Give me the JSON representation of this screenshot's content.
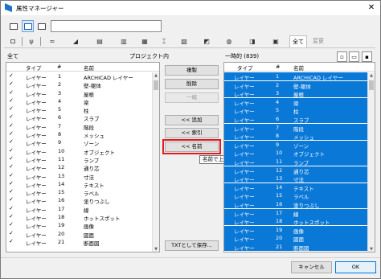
{
  "window": {
    "title": "属性マネージャー",
    "close_glyph": "✕"
  },
  "toolbar": {
    "view_buttons": [
      "list-view-icon",
      "detail-view-icon",
      "split-view-icon"
    ],
    "search_value": "",
    "categories": [
      "layer-icon",
      "pen-icon",
      "line-type-icon",
      "fill-icon",
      "surface-icon",
      "material-icon",
      "composite-icon",
      "profile-icon",
      "zone-icon",
      "mep-icon",
      "city-icon",
      "renovation-icon",
      "building-icon"
    ],
    "tabs": [
      {
        "label": "全て",
        "active": true
      },
      {
        "label": "変更",
        "active": false
      }
    ]
  },
  "left_panel": {
    "caption": "全て",
    "source": "プロジェクト内",
    "columns": {
      "type": "タイプ",
      "num": "#",
      "name": "名前"
    },
    "rows": [
      {
        "check": "✓",
        "type": "レイヤー",
        "num": "1",
        "name": "ARCHICAD レイヤー"
      },
      {
        "check": "✓",
        "type": "レイヤー",
        "num": "2",
        "name": "壁-躯体"
      },
      {
        "check": "✓",
        "type": "レイヤー",
        "num": "3",
        "name": "屋根"
      },
      {
        "check": "✓",
        "type": "レイヤー",
        "num": "4",
        "name": "梁"
      },
      {
        "check": "✓",
        "type": "レイヤー",
        "num": "5",
        "name": "柱"
      },
      {
        "check": "✓",
        "type": "レイヤー",
        "num": "6",
        "name": "スラブ"
      },
      {
        "check": "✓",
        "type": "レイヤー",
        "num": "7",
        "name": "階段"
      },
      {
        "check": "✓",
        "type": "レイヤー",
        "num": "8",
        "name": "メッシュ"
      },
      {
        "check": "✓",
        "type": "レイヤー",
        "num": "9",
        "name": "ゾーン"
      },
      {
        "check": "✓",
        "type": "レイヤー",
        "num": "10",
        "name": "オブジェクト"
      },
      {
        "check": "✓",
        "type": "レイヤー",
        "num": "11",
        "name": "ランプ"
      },
      {
        "check": "✓",
        "type": "レイヤー",
        "num": "12",
        "name": "通り芯"
      },
      {
        "check": "✓",
        "type": "レイヤー",
        "num": "13",
        "name": "寸法"
      },
      {
        "check": "✓",
        "type": "レイヤー",
        "num": "14",
        "name": "テキスト"
      },
      {
        "check": "✓",
        "type": "レイヤー",
        "num": "15",
        "name": "ラベル"
      },
      {
        "check": "✓",
        "type": "レイヤー",
        "num": "16",
        "name": "塗りつぶし"
      },
      {
        "check": "✓",
        "type": "レイヤー",
        "num": "17",
        "name": "線"
      },
      {
        "check": "✓",
        "type": "レイヤー",
        "num": "18",
        "name": "ホットスポット"
      },
      {
        "check": "✓",
        "type": "レイヤー",
        "num": "19",
        "name": "画像"
      },
      {
        "check": "✓",
        "type": "レイヤー",
        "num": "20",
        "name": "図面"
      },
      {
        "check": "✓",
        "type": "レイヤー",
        "num": "21",
        "name": "断面図"
      }
    ]
  },
  "middle_buttons": {
    "copy": "複製",
    "delete": "削除",
    "merge": "一緒",
    "add": "<< 追加",
    "index": "<< 索引",
    "by_name": "<< 名前",
    "export_txt": "TXTとして保存..."
  },
  "tooltip": "名前で上書き",
  "right_panel": {
    "caption": "一時的 (839)",
    "columns": {
      "type": "タイプ",
      "num": "#",
      "name": "名前"
    },
    "rows": [
      {
        "type": "レイヤー",
        "num": "1",
        "name": "ARCHICAD レイヤー"
      },
      {
        "type": "レイヤー",
        "num": "2",
        "name": "壁-躯体"
      },
      {
        "type": "レイヤー",
        "num": "3",
        "name": "屋根"
      },
      {
        "type": "レイヤー",
        "num": "4",
        "name": "梁"
      },
      {
        "type": "レイヤー",
        "num": "5",
        "name": "柱"
      },
      {
        "type": "レイヤー",
        "num": "6",
        "name": "スラブ"
      },
      {
        "type": "レイヤー",
        "num": "7",
        "name": "階段"
      },
      {
        "type": "レイヤー",
        "num": "8",
        "name": "メッシュ"
      },
      {
        "type": "レイヤー",
        "num": "9",
        "name": "ゾーン"
      },
      {
        "type": "レイヤー",
        "num": "10",
        "name": "オブジェクト"
      },
      {
        "type": "レイヤー",
        "num": "11",
        "name": "ランプ"
      },
      {
        "type": "レイヤー",
        "num": "12",
        "name": "通り芯"
      },
      {
        "type": "レイヤー",
        "num": "13",
        "name": "寸法"
      },
      {
        "type": "レイヤー",
        "num": "14",
        "name": "テキスト"
      },
      {
        "type": "レイヤー",
        "num": "15",
        "name": "ラベル"
      },
      {
        "type": "レイヤー",
        "num": "16",
        "name": "塗りつぶし"
      },
      {
        "type": "レイヤー",
        "num": "17",
        "name": "線"
      },
      {
        "type": "レイヤー",
        "num": "18",
        "name": "ホットスポット"
      },
      {
        "type": "レイヤー",
        "num": "19",
        "name": "画像"
      },
      {
        "type": "レイヤー",
        "num": "20",
        "name": "図面"
      },
      {
        "type": "レイヤー",
        "num": "21",
        "name": "断面図"
      }
    ]
  },
  "footer": {
    "cancel": "キャンセル",
    "ok": "OK"
  },
  "colors": {
    "selection": "#0a78d7",
    "highlight_frame": "#e21b1b"
  }
}
